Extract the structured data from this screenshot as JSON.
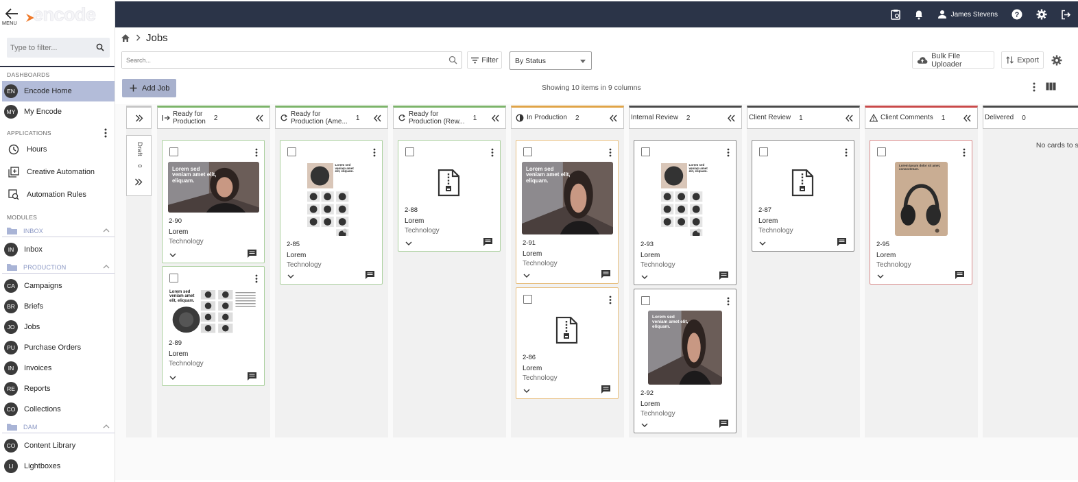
{
  "app": {
    "menu_label": "MENU",
    "logo_text": "encode"
  },
  "sidebar": {
    "filter_placeholder": "Type to filter...",
    "dashboards_label": "DASHBOARDS",
    "dashboards": [
      {
        "abbr": "EN",
        "label": "Encode Home",
        "active": true
      },
      {
        "abbr": "MY",
        "label": "My Encode"
      }
    ],
    "applications_label": "APPLICATIONS",
    "applications": [
      {
        "icon": "clock-icon",
        "label": "Hours"
      },
      {
        "icon": "add-box-icon",
        "label": "Creative Automation"
      },
      {
        "icon": "automation-icon",
        "label": "Automation Rules"
      }
    ],
    "modules_label": "MODULES",
    "groups": {
      "inbox": {
        "label": "INBOX",
        "items": [
          {
            "abbr": "IN",
            "label": "Inbox"
          }
        ]
      },
      "production": {
        "label": "PRODUCTION",
        "items": [
          {
            "abbr": "CA",
            "label": "Campaigns"
          },
          {
            "abbr": "BR",
            "label": "Briefs"
          },
          {
            "abbr": "JO",
            "label": "Jobs"
          },
          {
            "abbr": "PU",
            "label": "Purchase Orders"
          },
          {
            "abbr": "IN",
            "label": "Invoices"
          },
          {
            "abbr": "RE",
            "label": "Reports"
          },
          {
            "abbr": "CO",
            "label": "Collections"
          }
        ]
      },
      "dam": {
        "label": "DAM",
        "items": [
          {
            "abbr": "CO",
            "label": "Content Library"
          },
          {
            "abbr": "LI",
            "label": "Lightboxes"
          }
        ]
      }
    }
  },
  "topbar": {
    "user_name": "James Stevens",
    "icons": [
      "clipboard-icon",
      "bell-icon",
      "user-icon",
      "help-icon",
      "settings-icon",
      "logout-icon"
    ]
  },
  "page": {
    "title": "Jobs"
  },
  "toolbar": {
    "search_placeholder": "Search...",
    "filter_label": "Filter",
    "group_by": "By Status",
    "bulk_uploader_label": "Bulk File Uploader",
    "export_label": "Export"
  },
  "actions": {
    "add_job_label": "Add Job",
    "showing_text": "Showing 10 items in 9 columns"
  },
  "board": {
    "draft": {
      "name": "Draft",
      "count": "0"
    },
    "empty_text": "No cards to show",
    "columns": [
      {
        "name_lines": [
          "Ready for",
          "Production"
        ],
        "count": "2",
        "icon": "arrow-right-icon",
        "color": "#7cb46a",
        "cards": [
          {
            "id": "2-90",
            "title": "Lorem",
            "subtitle": "Technology",
            "thumb": "photo-woman",
            "thumb_text": "Lorem sed veniam amet elit, eliquam."
          },
          {
            "id": "2-89",
            "title": "Lorem",
            "subtitle": "Technology",
            "thumb": "layout-grid",
            "thumb_text": "Lorem sed veniam amet elit, eliquam."
          }
        ]
      },
      {
        "name_lines": [
          "Ready for",
          "Production (Ame..."
        ],
        "count": "1",
        "icon": "refresh-icon",
        "color": "#7cb46a",
        "cards": [
          {
            "id": "2-85",
            "title": "Lorem",
            "subtitle": "Technology",
            "thumb": "product-sheet",
            "thumb_text": "Lorem sed veniam amet elit, eliquam."
          }
        ]
      },
      {
        "name_lines": [
          "Ready for",
          "Production (Rew..."
        ],
        "count": "1",
        "icon": "refresh-icon",
        "color": "#7cb46a",
        "cards": [
          {
            "id": "2-88",
            "title": "Lorem",
            "subtitle": "Technology",
            "thumb": "zip"
          }
        ]
      },
      {
        "name_lines": [
          "In Production"
        ],
        "count": "2",
        "icon": "progress-icon",
        "color": "#e0a447",
        "cards": [
          {
            "id": "2-91",
            "title": "Lorem",
            "subtitle": "Technology",
            "thumb": "photo-woman-lg",
            "thumb_text": "Lorem sed veniam amet elit, eliquam."
          },
          {
            "id": "2-86",
            "title": "Lorem",
            "subtitle": "Technology",
            "thumb": "zip"
          }
        ]
      },
      {
        "name_lines": [
          "Internal Review"
        ],
        "count": "2",
        "icon": "",
        "color": "#4a4a4a",
        "cards": [
          {
            "id": "2-93",
            "title": "Lorem",
            "subtitle": "Technology",
            "thumb": "product-sheet",
            "thumb_text": "Lorem sed veniam amet elit, eliquam."
          },
          {
            "id": "2-92",
            "title": "Lorem",
            "subtitle": "Technology",
            "thumb": "photo-woman-sq",
            "thumb_text": "Lorem sed veniam amet elit, eliquam."
          }
        ]
      },
      {
        "name_lines": [
          "Client Review"
        ],
        "count": "1",
        "icon": "",
        "color": "#4a4a4a",
        "cards": [
          {
            "id": "2-87",
            "title": "Lorem",
            "subtitle": "Technology",
            "thumb": "zip"
          }
        ]
      },
      {
        "name_lines": [
          "Client Comments"
        ],
        "count": "1",
        "icon": "warning-icon",
        "color": "#c94a4a",
        "cards": [
          {
            "id": "2-95",
            "title": "Lorem",
            "subtitle": "Technology",
            "thumb": "headphones-ad",
            "thumb_text": "Lorem ipsum dolor sit amet, consectetuer."
          }
        ]
      },
      {
        "name_lines": [
          "Delivered"
        ],
        "count": "0",
        "icon": "",
        "color": "#4a4a4a",
        "cards": []
      }
    ]
  }
}
